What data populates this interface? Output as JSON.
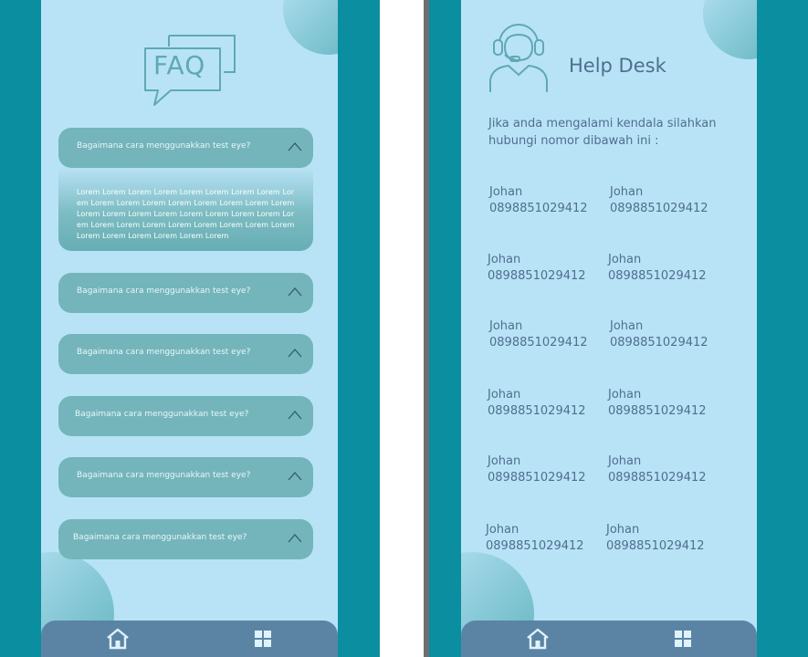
{
  "faq": {
    "logo_text": "FAQ",
    "items": [
      {
        "question": "Bagaimana cara menggunakkan test eye?",
        "answer": "Lorem Lorem Lorem Lorem Lorem Lorem Lorem Lorem Lorem Lorem Lorem Lorem Lorem Lorem Lorem Lorem Lorem Lorem Lorem Lorem Lorem Lorem Lorem Lorem Lorem Lorem Lorem Lorem Lorem Lorem Lorem Lorem Lorem Lorem Lorem Lorem Lorem Lorem Lorem Lorem",
        "expanded": true
      },
      {
        "question": "Bagaimana cara menggunakkan test eye?"
      },
      {
        "question": "Bagaimana cara menggunakkan test eye?"
      },
      {
        "question": "Bagaimana cara menggunakkan test eye?"
      },
      {
        "question": "Bagaimana cara menggunakkan test eye?"
      },
      {
        "question": "Bagaimana cara menggunakkan test eye?"
      }
    ]
  },
  "helpdesk": {
    "title": "Help Desk",
    "intro": "Jika anda mengalami kendala silahkan hubungi nomor dibawah ini :",
    "contacts": [
      {
        "name": "Johan",
        "phone": "0898851029412"
      },
      {
        "name": "Johan",
        "phone": "0898851029412"
      },
      {
        "name": "Johan",
        "phone": "0898851029412"
      },
      {
        "name": "Johan",
        "phone": "0898851029412"
      },
      {
        "name": "Johan",
        "phone": "0898851029412"
      },
      {
        "name": "Johan",
        "phone": "0898851029412"
      },
      {
        "name": "Johan",
        "phone": "0898851029412"
      },
      {
        "name": "Johan",
        "phone": "0898851029412"
      },
      {
        "name": "Johan",
        "phone": "0898851029412"
      },
      {
        "name": "Johan",
        "phone": "0898851029412"
      },
      {
        "name": "Johan",
        "phone": "0898851029412"
      },
      {
        "name": "Johan",
        "phone": "0898851029412"
      }
    ]
  },
  "nav": {
    "icons": [
      "home-icon",
      "grid-icon"
    ]
  },
  "colors": {
    "teal": "#0b8ea0",
    "screen_bg": "#b8e3f6",
    "faq_item": "#73b5bb",
    "nav_bar": "#5b84a4",
    "text_dark": "#4f6e8f"
  }
}
